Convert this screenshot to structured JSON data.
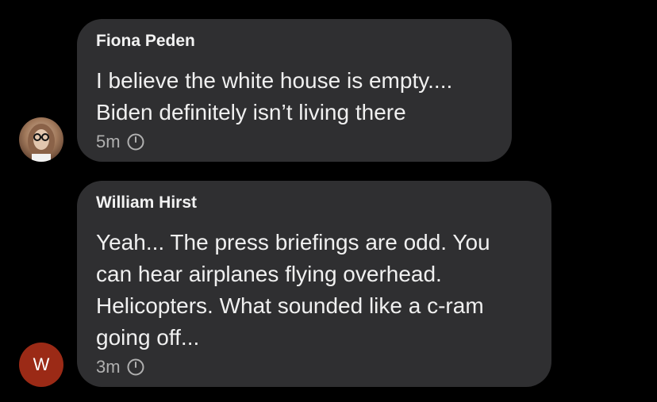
{
  "comments": [
    {
      "author": "Fiona Peden",
      "text": "I believe the white house is empty....\nBiden definitely isn’t living there",
      "time": "5m",
      "avatar_icon": "profile-photo"
    },
    {
      "author": "William Hirst",
      "text": "Yeah... The press briefings are odd. You\ncan hear airplanes flying overhead.\nHelicopters. What sounded like a c-ram\ngoing off...",
      "time": "3m",
      "avatar_letter": "W",
      "avatar_color": "#9b2a16"
    }
  ],
  "colors": {
    "background": "#000000",
    "bubble": "#2f2f31",
    "text": "#f0f0f0",
    "meta": "#b0b0b0"
  }
}
